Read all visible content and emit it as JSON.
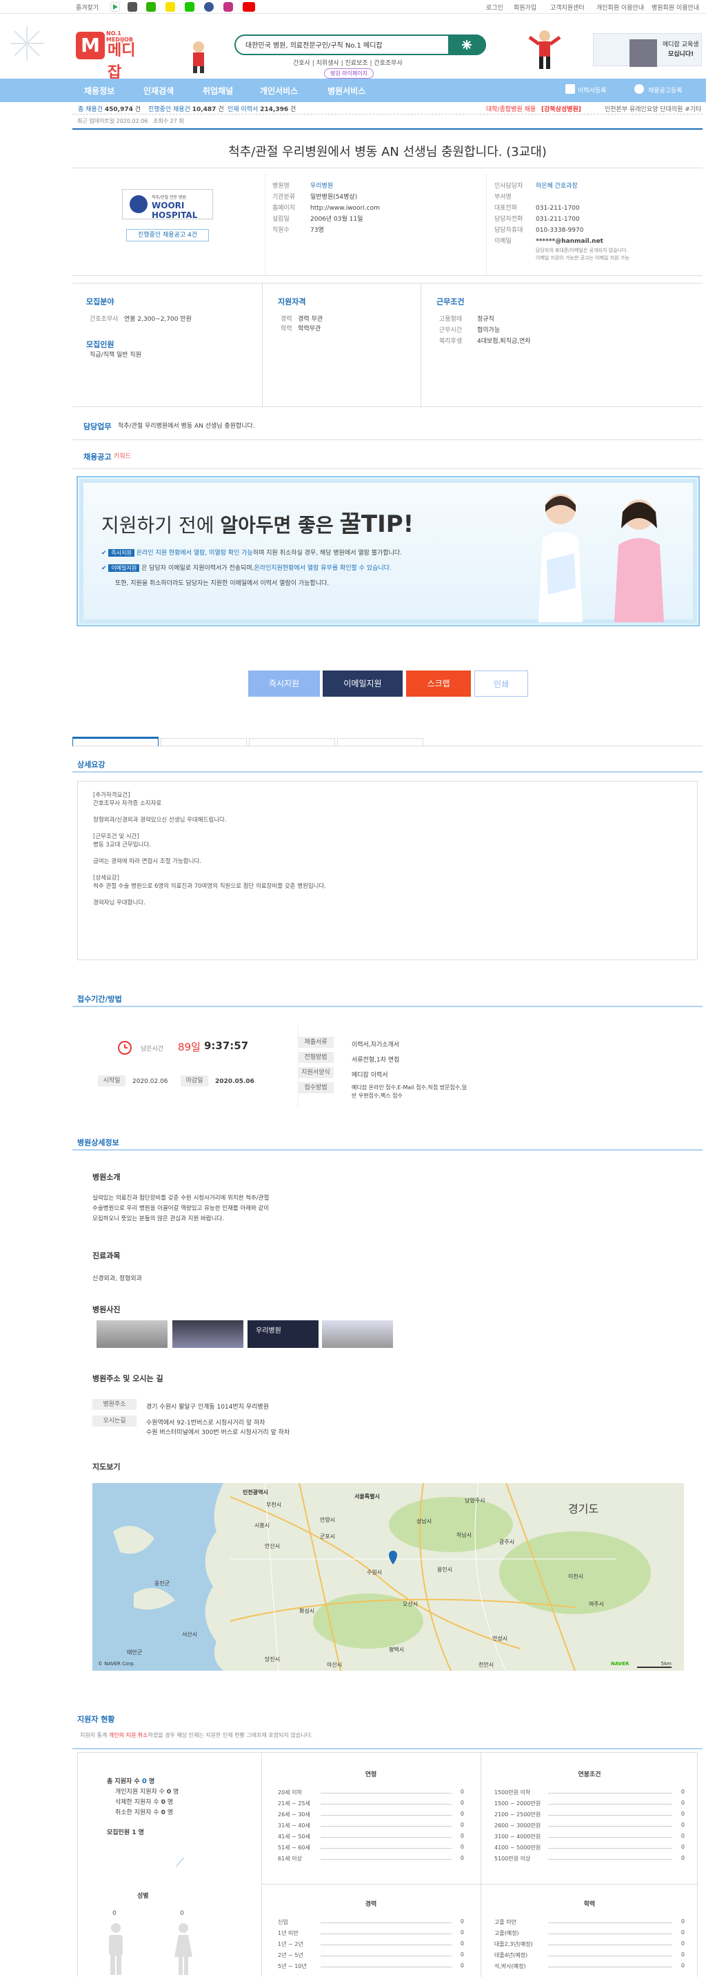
{
  "util": {
    "bookmark": "즐겨찾기",
    "login": "로그인",
    "join": "회원가입",
    "customer": "고객지원센터",
    "personal_guide": "개인회원 이용안내",
    "hospital_guide": "병원회원 이용안내"
  },
  "search": {
    "value": "대한민국 병원, 의료전문구인/구직 No.1 메디잡",
    "keywords": "간호사 | 치위생사 | 진료보조 | 간호조무사",
    "badge": "병원 마이페이지"
  },
  "ad": {
    "line1": "메디잡 교육생",
    "line2": "모십니다!"
  },
  "nav": {
    "items": [
      "채용정보",
      "인재검색",
      "취업채널",
      "개인서비스",
      "병원서비스"
    ],
    "resume": "이력서등록",
    "post": "채용공고등록"
  },
  "stats": {
    "total_label": "총 채용건",
    "total": "450,974",
    "ongoing_label": "진행중인 채용건",
    "ongoing": "10,487",
    "talent_label": "인재 이력서",
    "talent": "214,396",
    "unit": "건",
    "special": "대학/종합병원 채용",
    "special2": "[강북삼성병원]",
    "ticker": "인천본부 유레인요양 단대의원 #기타"
  },
  "post": {
    "update": "최근 업데이트일 2020.02.06",
    "views": "조회수 27 회",
    "title": "척추/관절 우리병원에서 병동 AN 선생님 충원합니다. (3교대)"
  },
  "hospital": {
    "logo_name": "WOORI HOSPITAL",
    "logo_sub": "척추/관절 전문 병원",
    "ongoing": "진행중인 채용공고 4건"
  },
  "info_mid": {
    "name_k": "병원명",
    "name": "우리병원",
    "type_k": "기관분류",
    "type": "일반병원(54병상)",
    "home_k": "홈페이지",
    "home": "http://www.iwoori.com",
    "est_k": "설립일",
    "est": "2006년 03월 11일",
    "emp_k": "직원수",
    "emp": "73명"
  },
  "info_right": {
    "hr_k": "인사담당자",
    "hr": "하은혜 간호과장",
    "dept_k": "부서명",
    "dept": "",
    "tel_k": "대표전화",
    "tel": "031-211-1700",
    "hrtel_k": "담당자전화",
    "hrtel": "031-211-1700",
    "mobile_k": "담당자휴대",
    "mobile": "010-3338-9970",
    "email_k": "이메일",
    "email": "******@hanmail.net",
    "note1": "담당자의 휴대폰/이메일은 공개되지 않습니다.",
    "note2": "이메일 지원이 가능한 공고는 이메일 지원 가능"
  },
  "recruit": {
    "area_title": "모집분야",
    "dept_k": "간호조무사",
    "pay": "연봉 2,300~2,700 만원",
    "people_title": "모집인원",
    "people": "직급/직책 일반 직원"
  },
  "qual": {
    "title": "지원자격",
    "career_k": "경력",
    "career": "경력 무관",
    "edu_k": "학력",
    "edu": "학력무관"
  },
  "work": {
    "title": "근무조건",
    "type_k": "고용형태",
    "type": "정규직",
    "time_k": "근무시간",
    "time": "협의가능",
    "welfare_k": "복리후생",
    "welfare": "4대보험,퇴직금,연차"
  },
  "duty": {
    "label": "담당업무",
    "text": "척추/관절 우리병원에서 병동 AN 선생님 충원합니다.",
    "kw_label": "채용공고",
    "kw": "키워드"
  },
  "tip": {
    "title1": "지원하기 전에",
    "title2": "알아두면 좋은",
    "title3": "꿀TIP!",
    "b1": "즉시지원",
    "t1": "온라인 지원 현황에서 열람, 미열람 확인 가능",
    "t1b": "하며 지원 취소하실 경우, 해당 병원에서 열람 불가합니다.",
    "b2": "이메일지원",
    "t2": "은 담당자 이메일로 지원이력서가 전송되며,",
    "t2b": "온라인지원현황에서 열람 유무를 확인할 수 있습니다.",
    "t3": "또한, 지원을 취소하더라도 담당자는 지원한 이메일에서 이력서 열람이 가능합니다."
  },
  "actions": {
    "apply": "즉시지원",
    "email": "이메일지원",
    "scrap": "스크랩",
    "print": "인쇄"
  },
  "detail": {
    "title": "상세요강",
    "lines": [
      "[추가자격요건]",
      "간호조무사 자격증 소지자로",
      "정형외과/신경외과 경력있으신 선생님 우대해드립니다.",
      "[근무조건 및 시간]",
      "병동 3교대 근무입니다.",
      "급여는 경력에 따라 면접시 조절 가능합니다.",
      "[상세요강]",
      "척추 관절 수술 병원으로 6명의 의료진과 70여명의 직원으로 첨단 의료장비를 갖춘 병원입니다.",
      "경력자님 우대합니다."
    ]
  },
  "period": {
    "title": "접수기간/방법",
    "remain_label": "남은시간",
    "remain_d": "89일",
    "remain_t": "9:37:57",
    "start_k": "시작일",
    "start": "2020.02.06",
    "end_k": "마감일",
    "end": "2020.05.06",
    "doc_k": "제출서류",
    "doc": "이력서,자기소개서",
    "proc_k": "전형방법",
    "proc": "서류전형,1차 면접",
    "form_k": "지원서양식",
    "form": "메디잡 이력서",
    "method_k": "접수방법",
    "method": "메디잡 온라인 접수,E-Mail 접수,직접 방문접수,일반 우편접수,팩스 접수"
  },
  "hinfo": {
    "title": "병원상세정보",
    "intro_title": "병원소개",
    "intro": [
      "실력있는 의료진과 첨단장비를 갖춘 수원 시청사거리에 위치한 척추/관절",
      "수술병원으로 우리 병원을 이끌어갈 역량있고 유능한 인재를 아래와 같이",
      "모집하오니 뜻있는 분들의 많은 관심과 지원 바랍니다."
    ],
    "subject_title": "진료과목",
    "subject": "신경외과, 정형외과",
    "photo_title": "병원사진",
    "photo_sign": "우리병원",
    "addr_title": "병원주소 및 오시는 길",
    "addr_k": "병원주소",
    "addr": "경기 수원시 팔달구 인계동 1014번지 우리병원",
    "way_k": "오시는길",
    "way1": "수원역에서 92-1번버스로 시청사거리 앞 하차",
    "way2": "수원 버스터미널에서 300번 버스로 시청사거리 앞 하차",
    "map_title": "지도보기",
    "map_credit": "© NAVER Corp.",
    "map_logo": "NAVER",
    "map_scale": "5km"
  },
  "map_labels": [
    "인천광역시",
    "부천시",
    "서울특별시",
    "경기도",
    "시흥시",
    "안양시",
    "군포시",
    "성남시",
    "용인시",
    "이천시",
    "안산시",
    "수원시",
    "오산시",
    "평택시",
    "화성시",
    "안성시",
    "천안시",
    "아산시",
    "당진시",
    "서산시",
    "옹진군",
    "태안군",
    "남양주시",
    "하남시",
    "광주시",
    "여주시"
  ],
  "stat": {
    "title": "지원자 현황",
    "note_pre": "지원자 통계",
    "note_red": "개인의 지원 취소",
    "note_post": "하셨을 경우 해당 인재는 지원한 인재 현황 그래프에 포함되지 않습니다.",
    "total_k": "총 지원자 수",
    "total": "0",
    "total_u": "명",
    "apply_k": "개인지원 지원자 수",
    "apply": "0",
    "del_k": "삭제한 지원자 수",
    "del": "0",
    "cancel_k": "취소한 지원자 수",
    "cancel": "0",
    "people_k": "모집인원",
    "people": "1",
    "people_u": "명",
    "gender_title": "성별",
    "male": "0",
    "female": "0",
    "age_title": "연령",
    "age_rows": [
      "20세 이하",
      "21세 ~ 25세",
      "26세 ~ 30세",
      "31세 ~ 40세",
      "41세 ~ 50세",
      "51세 ~ 60세",
      "61세 이상"
    ],
    "salary_title": "연봉조건",
    "salary_rows": [
      "1500만원 이하",
      "1500 ~ 2000만원",
      "2100 ~ 2500만원",
      "2600 ~ 3000만원",
      "3100 ~ 4000만원",
      "4100 ~ 5000만원",
      "5100만원 이상"
    ],
    "career_title": "경력",
    "career_rows": [
      "신입",
      "1년 미만",
      "1년 ~ 2년",
      "2년 ~ 5년",
      "5년 ~ 10년"
    ],
    "edu_title": "학력",
    "edu_rows": [
      "고졸 미만",
      "고졸(예정)",
      "대졸2,3년(예정)",
      "대졸4년(예정)",
      "석,박사(예정)"
    ],
    "zero": "0"
  }
}
